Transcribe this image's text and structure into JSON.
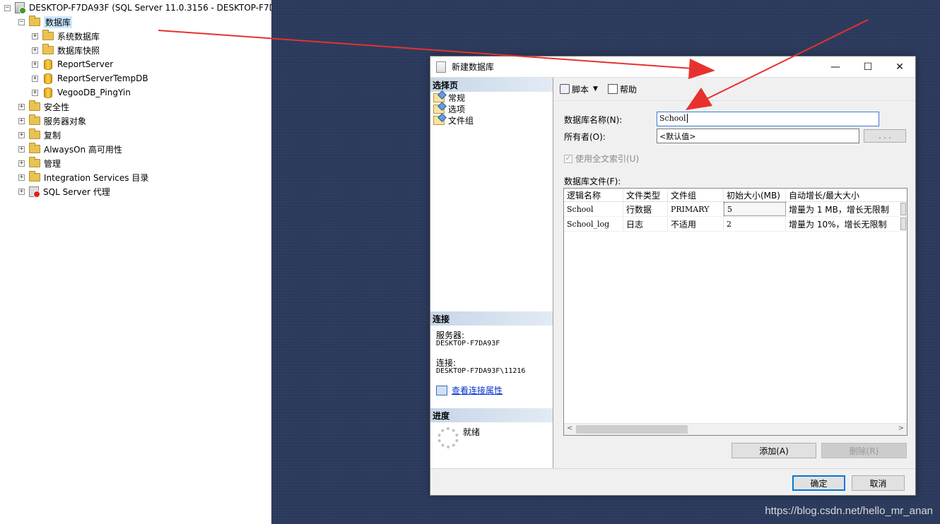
{
  "explorer": {
    "server_node": "DESKTOP-F7DA93F (SQL Server 11.0.3156 - DESKTOP-F7DA",
    "items": [
      {
        "label": "数据库",
        "expander": "⊟",
        "icon": "folder-icon"
      },
      {
        "label": "系统数据库",
        "expander": "⊞",
        "icon": "folder-icon"
      },
      {
        "label": "数据库快照",
        "expander": "⊞",
        "icon": "folder-icon"
      },
      {
        "label": "ReportServer",
        "expander": "⊞",
        "icon": "database-icon"
      },
      {
        "label": "ReportServerTempDB",
        "expander": "⊞",
        "icon": "database-icon"
      },
      {
        "label": "VegooDB_PingYin",
        "expander": "⊞",
        "icon": "database-icon"
      },
      {
        "label": "安全性",
        "expander": "⊞",
        "icon": "folder-icon"
      },
      {
        "label": "服务器对象",
        "expander": "⊞",
        "icon": "folder-icon"
      },
      {
        "label": "复制",
        "expander": "⊞",
        "icon": "folder-icon"
      },
      {
        "label": "AlwaysOn 高可用性",
        "expander": "⊞",
        "icon": "folder-icon"
      },
      {
        "label": "管理",
        "expander": "⊞",
        "icon": "folder-icon"
      },
      {
        "label": "Integration Services 目录",
        "expander": "⊞",
        "icon": "folder-icon"
      },
      {
        "label": "SQL Server 代理",
        "expander": "⊞",
        "icon": "sql-agent-icon"
      }
    ]
  },
  "dialog": {
    "title": "新建数据库",
    "window_buttons": {
      "minimize": "—",
      "maximize": "☐",
      "close": "✕"
    },
    "left": {
      "select_page_header": "选择页",
      "pages": [
        "常规",
        "选项",
        "文件组"
      ],
      "connection_header": "连接",
      "server_label": "服务器:",
      "server_value": "DESKTOP-F7DA93F",
      "connection_label": "连接:",
      "connection_value": "DESKTOP-F7DA93F\\11216",
      "view_connection_link": "查看连接属性",
      "progress_header": "进度",
      "progress_status": "就绪"
    },
    "toolbar": {
      "script_label": "脚本",
      "help_label": "帮助"
    },
    "form": {
      "db_name_label": "数据库名称(N):",
      "db_name_value": "School",
      "owner_label": "所有者(O):",
      "owner_value": "<默认值>",
      "owner_browse": ". . .",
      "fulltext_label": "使用全文索引(U)",
      "fulltext_checked": true,
      "files_label": "数据库文件(F):"
    },
    "grid": {
      "columns": [
        "逻辑名称",
        "文件类型",
        "文件组",
        "初始大小(MB)",
        "自动增长/最大大小"
      ],
      "rows": [
        [
          "School",
          "行数据",
          "PRIMARY",
          "5",
          "增量为 1 MB，增长无限制"
        ],
        [
          "School_log",
          "日志",
          "不适用",
          "2",
          "增量为 10%，增长无限制"
        ]
      ]
    },
    "add_button": "添加(A)",
    "remove_button": "删除(R)",
    "ok_button": "确定",
    "cancel_button": "取消"
  },
  "watermark": "https://blog.csdn.net/hello_mr_anan",
  "colors": {
    "workspace": "#2b3a5c",
    "arrow": "#e8312f",
    "header_gradient": "#c6d6e8"
  }
}
